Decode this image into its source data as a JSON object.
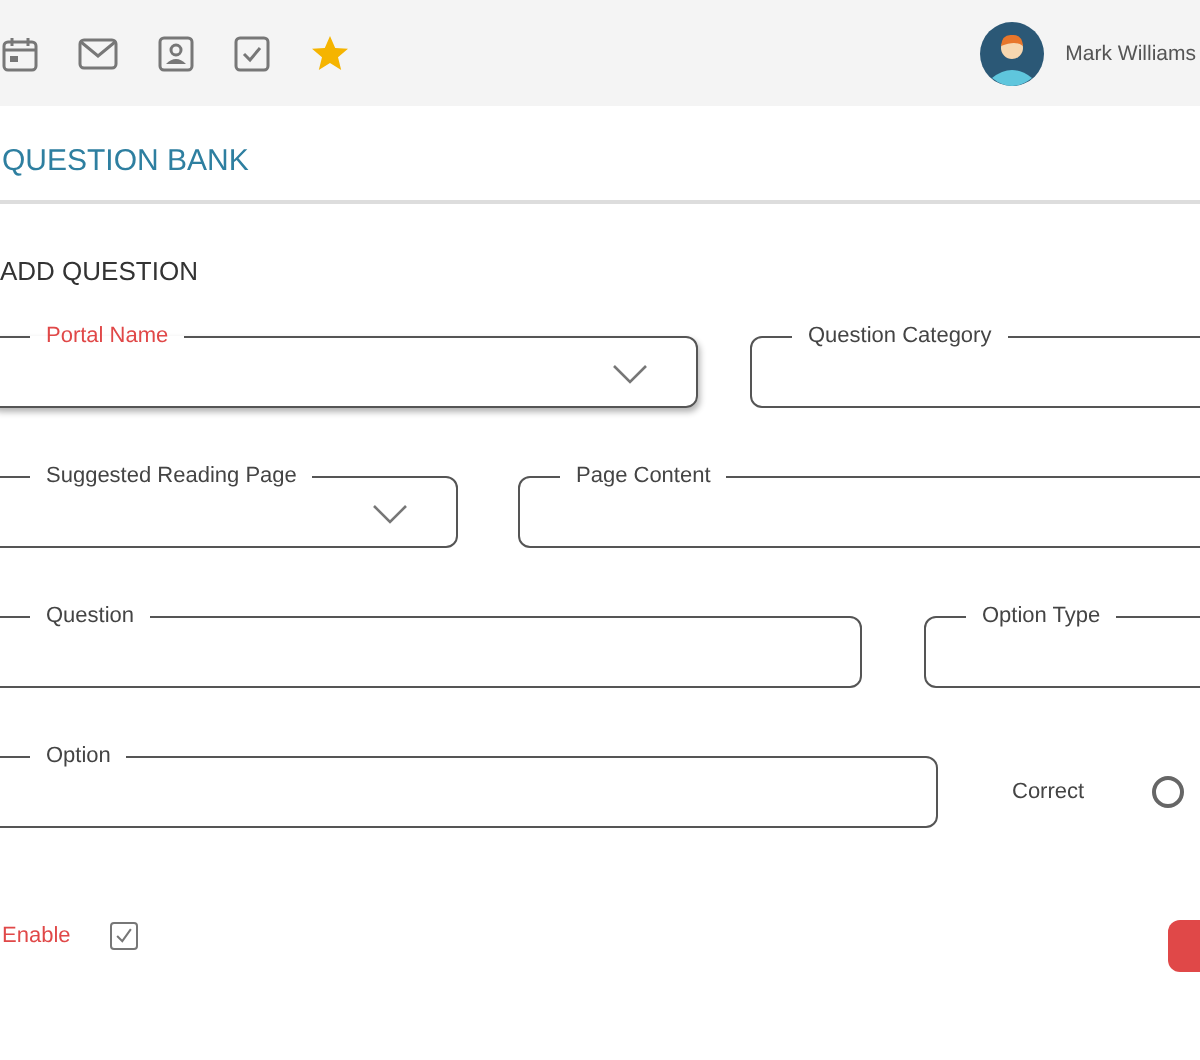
{
  "user": {
    "name": "Mark Williams"
  },
  "page_title": "QUESTION BANK",
  "section_title": "ADD QUESTION",
  "rows": [
    {
      "fields": [
        {
          "kind": "dropdown",
          "label": "Portal Name",
          "highlighted": true
        },
        {
          "kind": "text",
          "label": "Question Category",
          "highlighted": false
        }
      ]
    },
    {
      "fields": [
        {
          "kind": "dropdown",
          "label": "Suggested Reading Page",
          "highlighted": false
        },
        {
          "kind": "text",
          "label": "Page Content",
          "highlighted": false
        }
      ]
    },
    {
      "fields": [
        {
          "kind": "text",
          "label": "Question",
          "highlighted": false
        },
        {
          "kind": "text",
          "label": "Option Type",
          "highlighted": false
        }
      ]
    },
    {
      "fields": [
        {
          "kind": "text",
          "label": "Option",
          "highlighted": false
        },
        {
          "kind": "radio",
          "label": "Correct",
          "selected": false
        }
      ]
    }
  ],
  "enable": {
    "label": "Enable",
    "checked": true
  }
}
